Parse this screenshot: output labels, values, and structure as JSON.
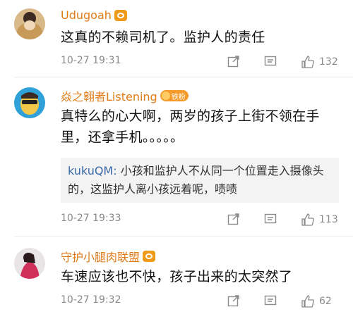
{
  "comments": [
    {
      "username": "Udugoah",
      "text": "这真的不赖司机了。监护人的责任",
      "time": "10-27 19:31",
      "likes": "132"
    },
    {
      "username": "焱之翱者Listening",
      "badge_text": "铁粉",
      "text": "真特么的心大啊，两岁的孩子上街不领在手里，还拿手机。。。。。",
      "reply": {
        "username": "kukuQM:",
        "text": "小孩和监护人不从同一个位置走入摄像头的，这监护人离小孩远着呢，啧啧"
      },
      "time": "10-27 19:33",
      "likes": "113"
    },
    {
      "username": "守护小腿肉联盟",
      "text": "车速应该也不快，孩子出来的太突然了",
      "time": "10-27 19:32",
      "likes": "62"
    }
  ],
  "colors": {
    "username": "#e07b17",
    "reply_username": "#3b6aa6",
    "meta": "#8a8a8a"
  },
  "icons": [
    "share-icon",
    "comment-icon",
    "like-icon",
    "vip-badge-icon"
  ]
}
